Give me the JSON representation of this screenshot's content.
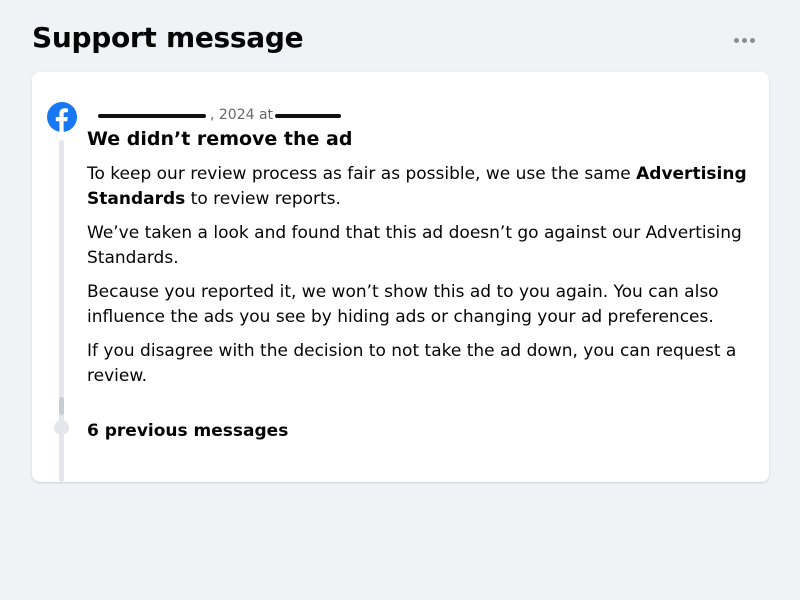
{
  "header": {
    "title": "Support message",
    "more_icon": "more-horizontal-icon"
  },
  "message": {
    "sender_icon": "facebook-logo",
    "brand_color": "#1877f2",
    "timestamp": ", 2024 at",
    "timestamp_redacted": true,
    "title": "We didn’t remove the ad",
    "paragraph1": {
      "before": "To keep our review process as fair as possible, we use the same ",
      "bold": "Advertising Standards",
      "after": " to review reports."
    },
    "paragraph2": "We’ve taken a look and found that this ad doesn’t go against our Advertising Standards.",
    "paragraph3": "Because you reported it, we won’t show this ad to you again. You can also influence the ads you see by hiding ads or changing your ad preferences.",
    "paragraph4": "If you disagree with the decision to not take the ad down, you can request a review."
  },
  "previous": {
    "label": "6 previous messages"
  }
}
